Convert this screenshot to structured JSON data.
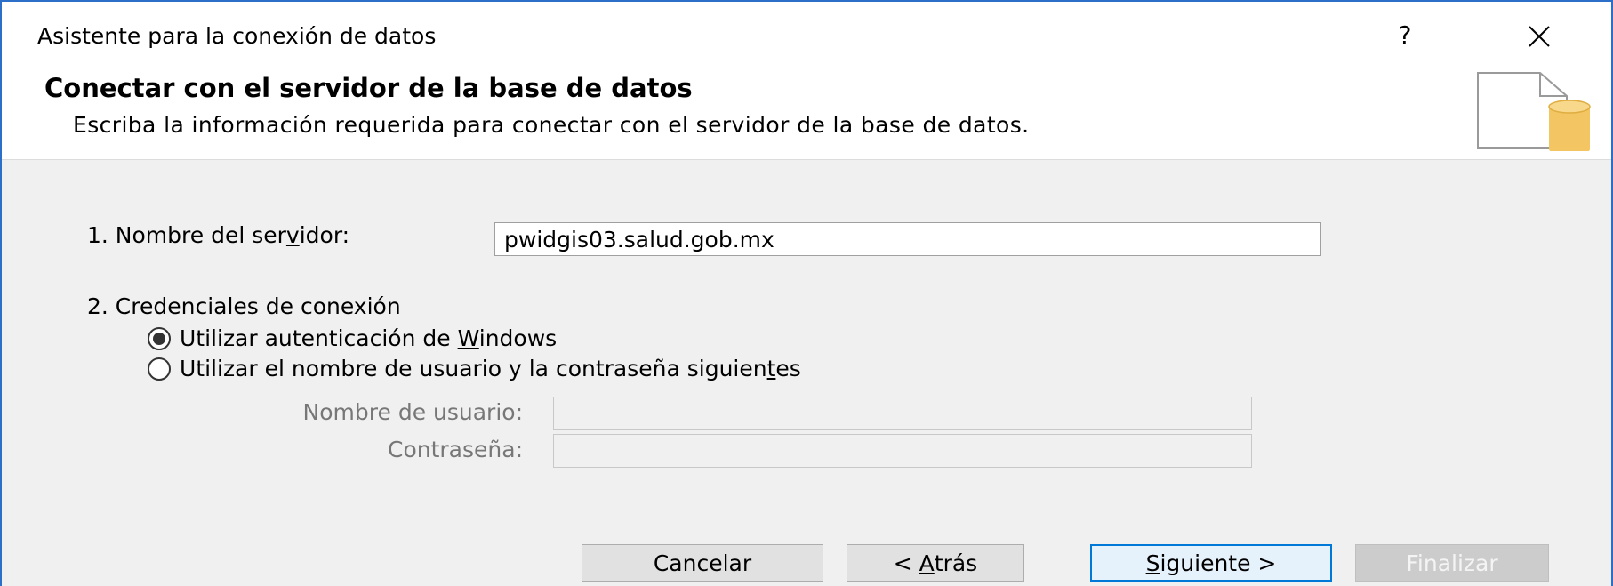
{
  "window": {
    "title": "Asistente para la conexión de datos",
    "help_label": "?",
    "close_icon": "close-x-icon"
  },
  "header": {
    "title": "Conectar con el servidor de la base de datos",
    "subtitle": "Escriba la información requerida para conectar con el servidor de la base de datos.",
    "icon": "document-database-icon"
  },
  "server": {
    "label_before": "1. Nombre del ser",
    "label_accel": "v",
    "label_after": "idor:",
    "value": "pwidgis03.salud.gob.mx"
  },
  "credentials": {
    "heading": "2. Credenciales de conexión",
    "option_windows": {
      "before": "Utilizar autenticación de ",
      "accel": "W",
      "after": "indows",
      "checked": true
    },
    "option_userpass": {
      "before": "Utilizar el nombre de usuario y la contraseña siguien",
      "accel": "t",
      "after": "es",
      "checked": false
    },
    "username_label": "Nombre de usuario:",
    "username_value": "",
    "password_label": "Contraseña:",
    "password_value": ""
  },
  "buttons": {
    "cancel": "Cancelar",
    "back_before": "< ",
    "back_accel": "A",
    "back_after": "trás",
    "next_accel": "S",
    "next_after": "iguiente >",
    "finish": "Finalizar"
  },
  "colors": {
    "window_border": "#2b6fc9",
    "default_button_border": "#0078d7",
    "database_icon": "#f3c663"
  }
}
